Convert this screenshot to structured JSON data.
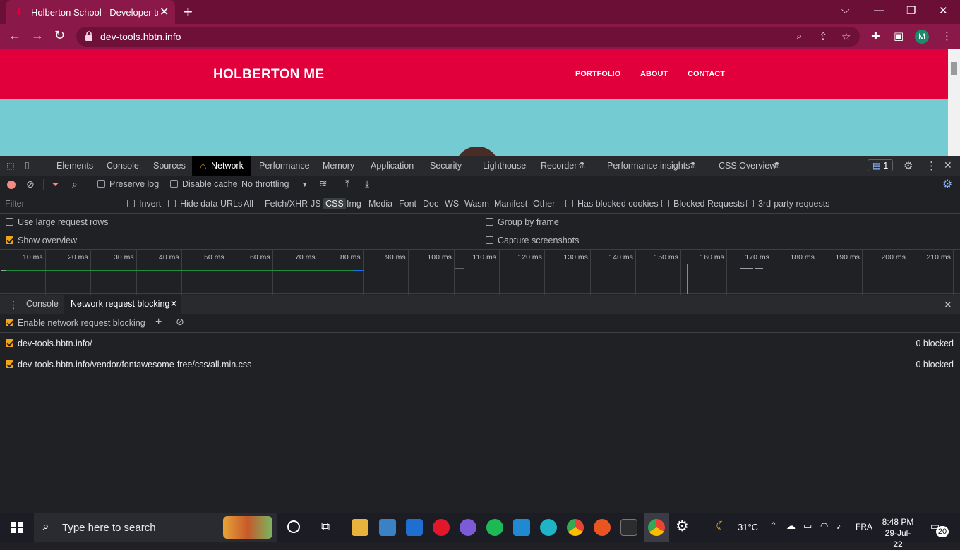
{
  "browser": {
    "tab_title": "Holberton School - Developer to",
    "url": "dev-tools.hbtn.info",
    "avatar_letter": "M"
  },
  "site": {
    "brand": "HOLBERTON ME",
    "nav": [
      "PORTFOLIO",
      "ABOUT",
      "CONTACT"
    ],
    "header_color": "#e1003c",
    "bg_color": "#75cbd2"
  },
  "devtools": {
    "tabs": [
      "Elements",
      "Console",
      "Sources",
      "Network",
      "Performance",
      "Memory",
      "Application",
      "Security",
      "Lighthouse",
      "Recorder",
      "Performance insights",
      "CSS Overview"
    ],
    "active_tab": "Network",
    "issues_count": "1",
    "toolbar": {
      "preserve_log": "Preserve log",
      "disable_cache": "Disable cache",
      "throttling": "No throttling"
    },
    "filter": {
      "placeholder": "Filter",
      "invert": "Invert",
      "hide_data_urls": "Hide data URLs",
      "types": [
        "All",
        "Fetch/XHR",
        "JS",
        "CSS",
        "Img",
        "Media",
        "Font",
        "Doc",
        "WS",
        "Wasm",
        "Manifest",
        "Other"
      ],
      "active_type": "CSS",
      "has_blocked_cookies": "Has blocked cookies",
      "blocked_requests": "Blocked Requests",
      "third_party": "3rd-party requests"
    },
    "options": {
      "large_rows": "Use large request rows",
      "group_by_frame": "Group by frame",
      "show_overview": "Show overview",
      "capture_screenshots": "Capture screenshots"
    },
    "timeline_ticks": [
      "10 ms",
      "20 ms",
      "30 ms",
      "40 ms",
      "50 ms",
      "60 ms",
      "70 ms",
      "80 ms",
      "90 ms",
      "100 ms",
      "110 ms",
      "120 ms",
      "130 ms",
      "140 ms",
      "150 ms",
      "160 ms",
      "170 ms",
      "180 ms",
      "190 ms",
      "200 ms",
      "210 ms"
    ],
    "drawer": {
      "tabs": [
        "Console",
        "Network request blocking"
      ],
      "active": "Network request blocking",
      "enable_label": "Enable network request blocking",
      "patterns": [
        {
          "pattern": "dev-tools.hbtn.info/",
          "count": "0 blocked"
        },
        {
          "pattern": "dev-tools.hbtn.info/vendor/fontawesome-free/css/all.min.css",
          "count": "0 blocked"
        }
      ]
    }
  },
  "taskbar": {
    "search_placeholder": "Type here to search",
    "weather": "31°C",
    "language": "FRA",
    "time": "8:48 PM",
    "date": "29-Jul-22",
    "notifications": "20"
  }
}
